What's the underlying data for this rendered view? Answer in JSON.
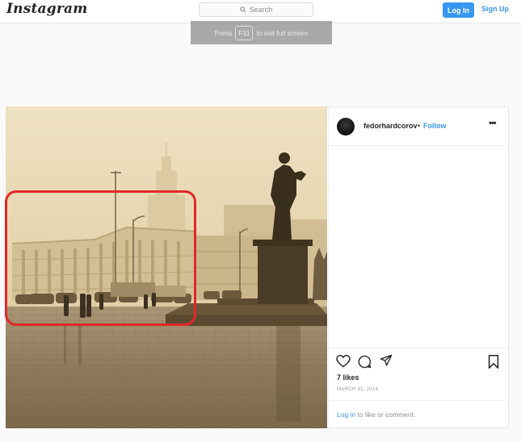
{
  "nav": {
    "logo": "Instagram",
    "search_placeholder": "Search",
    "login_label": "Log In",
    "signup_label": "Sign Up"
  },
  "fullscreen_notice": {
    "prefix": "Press",
    "key": "F11",
    "suffix": "to exit full screen"
  },
  "post": {
    "username": "fedorhardcorov",
    "separator": "•",
    "follow_label": "Follow",
    "more_label": "•••",
    "likes": "7 likes",
    "date": "MARCH 31, 2014",
    "comment_login": "Log in",
    "comment_suffix": " to like or comment."
  },
  "colors": {
    "accent": "#3897f0",
    "highlight": "#e22727",
    "sepia_sky": "#ead9b4",
    "sepia_ground": "#8f7c5e"
  },
  "icons": {
    "heart": "heart-icon",
    "comment": "comment-icon",
    "share": "share-icon",
    "bookmark": "bookmark-icon",
    "search": "search-icon"
  }
}
